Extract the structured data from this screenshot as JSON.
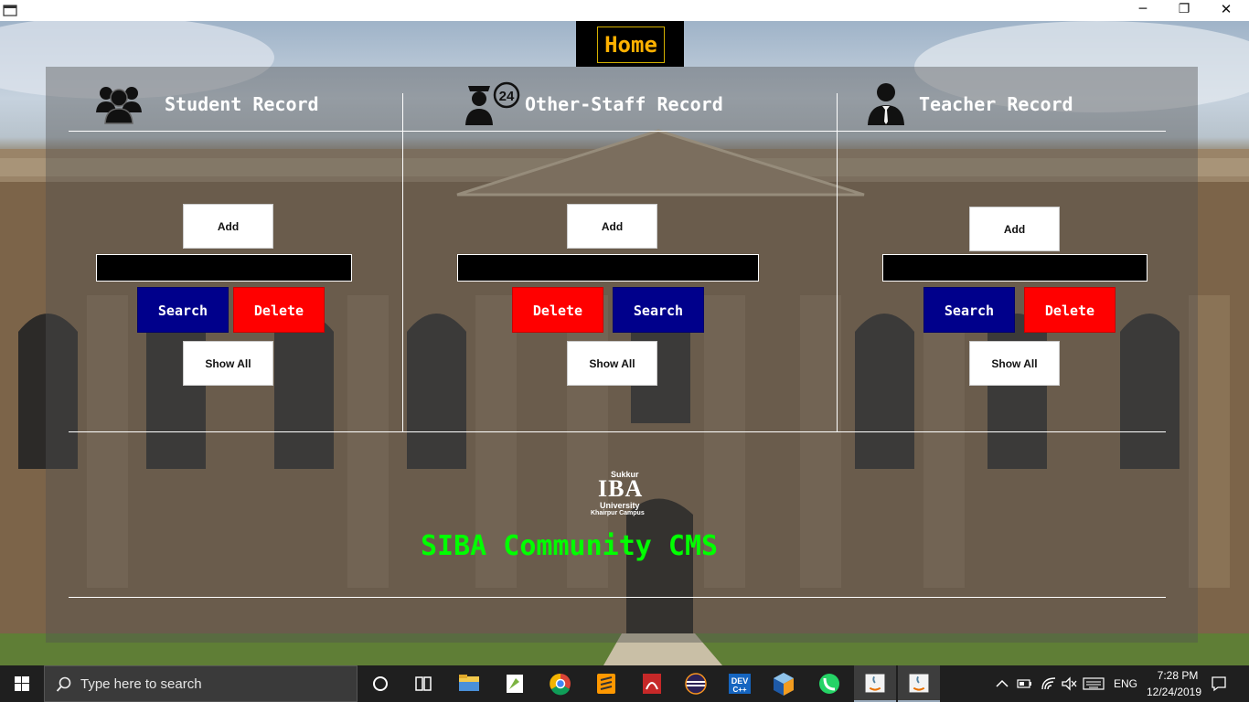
{
  "window": {
    "minimize": "─",
    "maximize": "❐",
    "close": "✕"
  },
  "header": {
    "home_label": "Home"
  },
  "sections": {
    "student": {
      "title": "Student Record",
      "add": "Add",
      "search": "Search",
      "delete": "Delete",
      "show_all": "Show All",
      "field_value": ""
    },
    "staff": {
      "title": "Other-Staff Record",
      "add": "Add",
      "search": "Search",
      "delete": "Delete",
      "show_all": "Show All",
      "field_value": ""
    },
    "teacher": {
      "title": "Teacher Record",
      "add": "Add",
      "search": "Search",
      "delete": "Delete",
      "show_all": "Show All",
      "field_value": ""
    }
  },
  "footer": {
    "brand": "SIBA Community CMS",
    "logo": {
      "top": "Sukkur",
      "main": "IBA",
      "line1": "University",
      "line2": "Khairpur Campus"
    }
  },
  "taskbar": {
    "search_placeholder": "Type here to search",
    "apps": [
      "cortana-icon",
      "task-view-icon",
      "file-explorer-icon",
      "notepad-plus-icon",
      "chrome-icon",
      "sublime-icon",
      "pdf-icon",
      "eclipse-icon",
      "devcpp-icon",
      "virtualbox-icon",
      "whatsapp-icon",
      "java-icon",
      "java-active-icon"
    ],
    "language": "ENG",
    "time": "7:28 PM",
    "date": "12/24/2019"
  },
  "colors": {
    "blue_button": "#00008b",
    "red_button": "#ff0000",
    "brand_green": "#00ff00",
    "home_text": "#ffb100"
  }
}
